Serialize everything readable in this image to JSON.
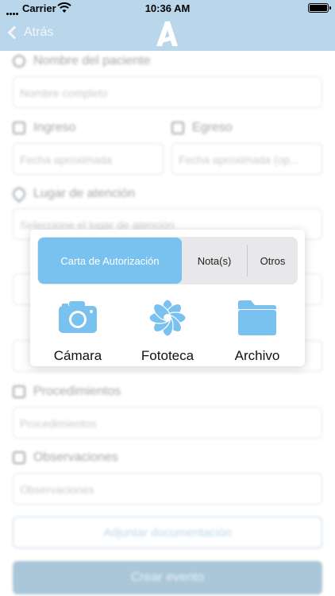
{
  "status_bar": {
    "carrier": "Carrier",
    "time": "10:36 AM"
  },
  "nav": {
    "back_label": "Atrás"
  },
  "form": {
    "patient_label": "Nombre del paciente",
    "patient_placeholder": "Nombre completo",
    "ingreso_label": "Ingreso",
    "ingreso_placeholder": "Fecha aproximada",
    "egreso_label": "Egreso",
    "egreso_placeholder": "Fecha aproximada (op...",
    "lugar_label": "Lugar de atención",
    "lugar_placeholder": "Seleccione el lugar de atención",
    "procedimientos_label": "Procedimientos",
    "procedimientos_placeholder": "Procedimientos",
    "observaciones_label": "Observaciones",
    "observaciones_placeholder": "Observaciones",
    "attach_button": "Adjuntar documentación",
    "create_button": "Crear evento"
  },
  "popup": {
    "segments": [
      "Carta de Autorización",
      "Nota(s)",
      "Otros"
    ],
    "selected_segment": "Carta de Autorización",
    "actions": [
      {
        "label": "Cámara",
        "icon": "camera-icon"
      },
      {
        "label": "Fototeca",
        "icon": "photos-flower-icon"
      },
      {
        "label": "Archivo",
        "icon": "folder-icon"
      }
    ]
  },
  "colors": {
    "nav_bar": "#b9d6ea",
    "accent": "#79c1ee",
    "segment_bg": "#e8e8ea"
  }
}
